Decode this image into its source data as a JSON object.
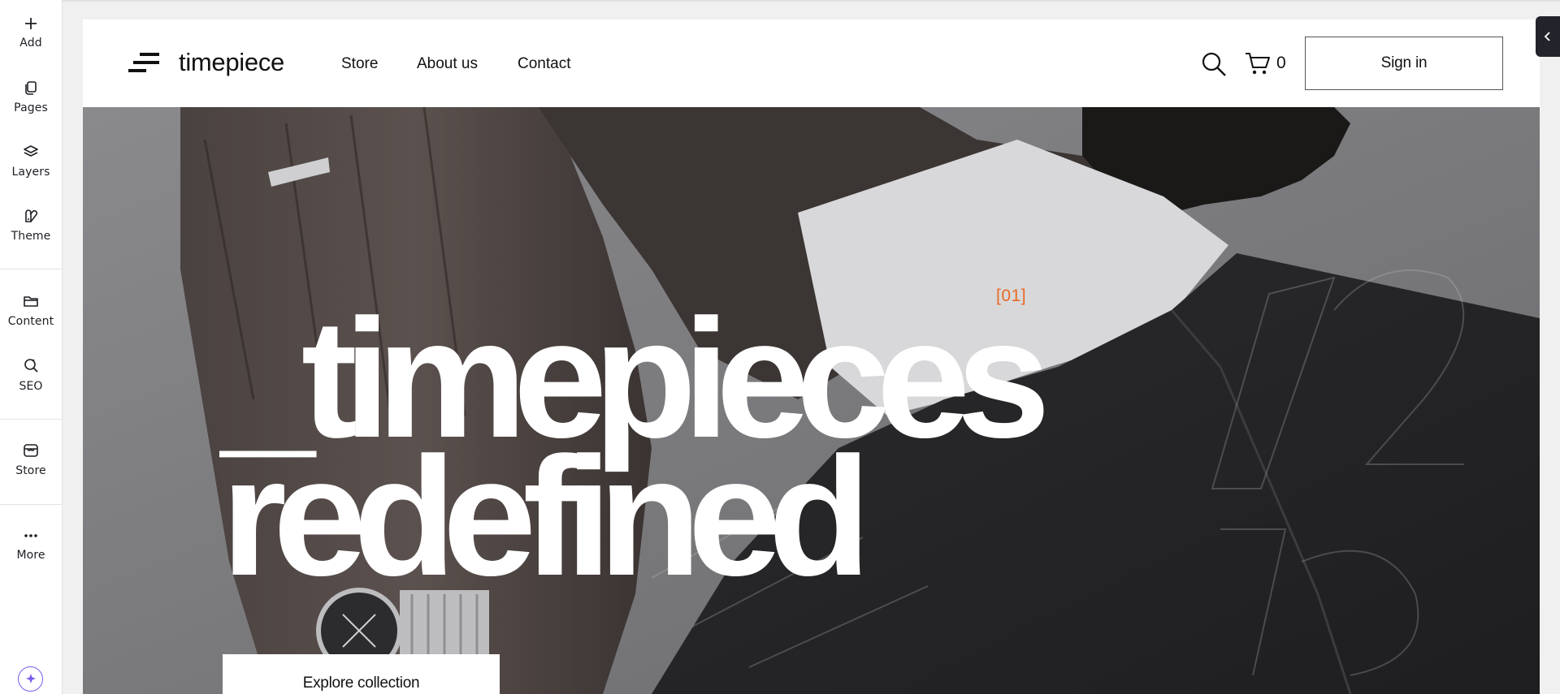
{
  "editor_rail": {
    "items": [
      {
        "label": "Add",
        "icon": "plus-icon"
      },
      {
        "label": "Pages",
        "icon": "pages-icon"
      },
      {
        "label": "Layers",
        "icon": "layers-icon"
      },
      {
        "label": "Theme",
        "icon": "theme-icon"
      },
      {
        "label": "Content",
        "icon": "folder-icon"
      },
      {
        "label": "SEO",
        "icon": "seo-search-icon"
      },
      {
        "label": "Store",
        "icon": "store-icon"
      },
      {
        "label": "More",
        "icon": "more-dots-icon"
      }
    ],
    "ai_icon": "sparkle-icon"
  },
  "site": {
    "logo_text": "timepiece",
    "nav": [
      "Store",
      "About us",
      "Contact"
    ],
    "cart_count": "0",
    "sign_in_label": "Sign in",
    "hero": {
      "index_label": "[01]",
      "title_line1": "_timepieces",
      "title_line2": "redefined",
      "cta_label": "Explore collection"
    }
  },
  "colors": {
    "accent_orange": "#e86a24",
    "ai_purple": "#7b5cf0",
    "collapse_tab": "#23242b"
  },
  "collapse_icon": "chevron-left-icon"
}
